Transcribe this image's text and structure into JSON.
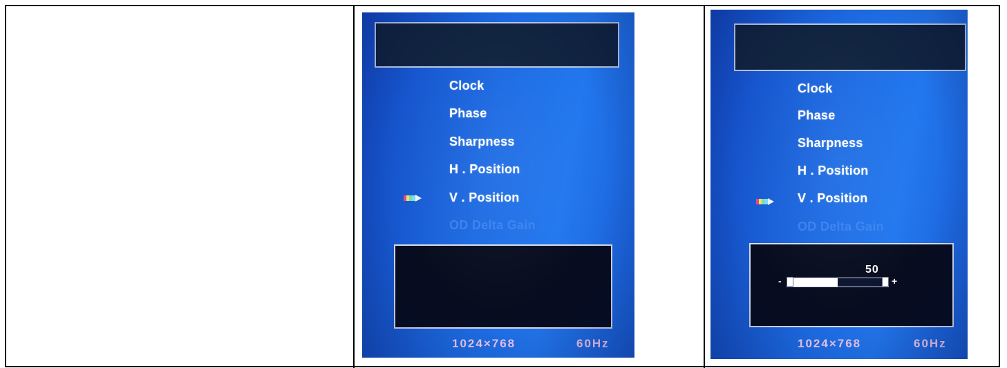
{
  "panels": [
    {
      "menu_items": [
        "Clock",
        "Phase",
        "Sharpness",
        "H . Position",
        "V . Position"
      ],
      "disabled_item": "OD  Delta  Gain",
      "selected_index": 4,
      "footer_resolution": "1024×768",
      "footer_refresh": "60Hz"
    },
    {
      "menu_items": [
        "Clock",
        "Phase",
        "Sharpness",
        "H . Position",
        "V . Position"
      ],
      "disabled_item": "OD  Delta  Gain",
      "selected_index": 4,
      "slider_value": "50",
      "slider_fraction": 0.5,
      "slider_minus": "-",
      "slider_plus": "+",
      "footer_resolution": "1024×768",
      "footer_refresh": "60Hz"
    }
  ],
  "colors": {
    "osd_blue": "#1c6ae2",
    "menu_text": "#ffffff",
    "disabled_text": "#3f86f2",
    "footer_text": "#f2c9ee",
    "pointer_icon": "multicolor-arrow"
  }
}
